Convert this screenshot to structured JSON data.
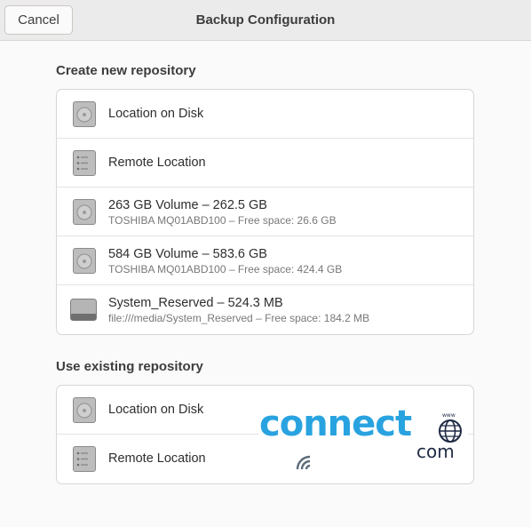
{
  "header": {
    "title": "Backup Configuration",
    "cancel_label": "Cancel"
  },
  "create_section": {
    "heading": "Create new repository",
    "items": [
      {
        "title": "Location on Disk",
        "subtitle": "",
        "icon": "drive-harddisk-icon"
      },
      {
        "title": "Remote Location",
        "subtitle": "",
        "icon": "network-server-icon"
      },
      {
        "title": "263 GB Volume – 262.5 GB",
        "subtitle": "TOSHIBA MQ01ABD100 – Free space: 26.6 GB",
        "icon": "drive-harddisk-icon"
      },
      {
        "title": "584 GB Volume – 583.6 GB",
        "subtitle": "TOSHIBA MQ01ABD100 – Free space: 424.4 GB",
        "icon": "drive-harddisk-icon"
      },
      {
        "title": "System_Reserved – 524.3 MB",
        "subtitle": "file:///media/System_Reserved – Free space: 184.2 MB",
        "icon": "drive-removable-icon"
      }
    ]
  },
  "existing_section": {
    "heading": "Use existing repository",
    "items": [
      {
        "title": "Location on Disk",
        "icon": "drive-harddisk-icon"
      },
      {
        "title": "Remote Location",
        "icon": "network-server-icon"
      }
    ]
  },
  "watermark": {
    "brand": "connect",
    "domain": "com",
    "web_label": "www"
  }
}
